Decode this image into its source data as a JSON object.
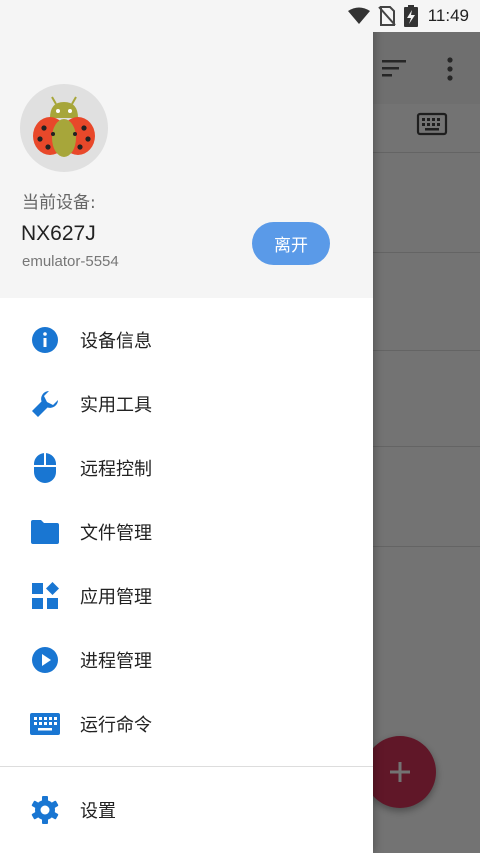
{
  "status_bar": {
    "time": "11:49"
  },
  "drawer": {
    "header": {
      "device_caption": "当前设备:",
      "device_name": "NX627J",
      "device_serial": "emulator-5554",
      "leave_label": "离开"
    },
    "menu_items": [
      {
        "label": "设备信息",
        "icon": "info-icon"
      },
      {
        "label": "实用工具",
        "icon": "wrench-icon"
      },
      {
        "label": "远程控制",
        "icon": "mouse-icon"
      },
      {
        "label": "文件管理",
        "icon": "folder-icon"
      },
      {
        "label": "应用管理",
        "icon": "apps-icon"
      },
      {
        "label": "进程管理",
        "icon": "play-circle-icon"
      },
      {
        "label": "运行命令",
        "icon": "keyboard-icon"
      }
    ],
    "settings_label": "设置"
  },
  "colors": {
    "accent": "#1976d2",
    "leave_button": "#5a9ae8",
    "fab": "#d6335a"
  }
}
